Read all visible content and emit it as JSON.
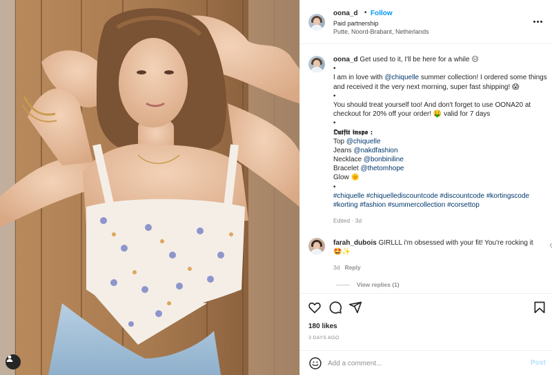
{
  "post": {
    "username": "oona_d",
    "follow_label": "Follow",
    "separator": "•",
    "paid_partnership": "Paid partnership",
    "location": "Putte, Noord-Brabant, Netherlands"
  },
  "caption": {
    "username": "oona_d",
    "first_line": "Get used to it, I'll be here for a while 😑",
    "bullet": "•",
    "p2_a": "I am in love with ",
    "p2_mention": "@chiquelle",
    "p2_b": " summer collection! I ordered some things",
    "p2_line2": "and received it the very next morning, super fast shipping! 😱",
    "p3_line1": "You should treat yourself too! And don't forget to use OONA20 at",
    "p3_line2": "checkout for 20% off your order! 🤑 valid for 7 days",
    "outfit_heading": "𝕺𝖚𝖙𝖋𝖎𝖙 𝖎𝖓𝖘𝖕𝖔 :",
    "outfit": [
      {
        "label": "Top ",
        "mention": "@chiquelle"
      },
      {
        "label": "Jeans ",
        "mention": "@nakdfashion"
      },
      {
        "label": "Necklace ",
        "mention": "@bonbiniline"
      },
      {
        "label": "Bracelet ",
        "mention": "@thetomhope"
      },
      {
        "label": "Glow 🌞",
        "mention": ""
      }
    ],
    "hashtags_line1": "#chiquelle #chiquellediscountcode #discountcode #kortingscode",
    "hashtags_line2": "#korting #fashion #summercollection #corsettop",
    "edited": "Edited · 3d"
  },
  "comment": {
    "username": "farah_dubois",
    "text": "GIRLLL i'm obsessed with your fit! You're rocking it",
    "emojis": "🤩✨",
    "time": "3d",
    "reply_label": "Reply",
    "view_replies": "View replies (1)"
  },
  "actions": {
    "icons": [
      "heart-icon",
      "comment-icon",
      "share-icon",
      "bookmark-icon"
    ],
    "likes": "180 likes",
    "date": "3 DAYS AGO"
  },
  "composer": {
    "placeholder": "Add a comment...",
    "post_label": "Post"
  },
  "colors": {
    "link": "#0095f6",
    "mention": "#00376b",
    "muted": "#8e8e8e",
    "post_disabled": "#b2dffc"
  }
}
